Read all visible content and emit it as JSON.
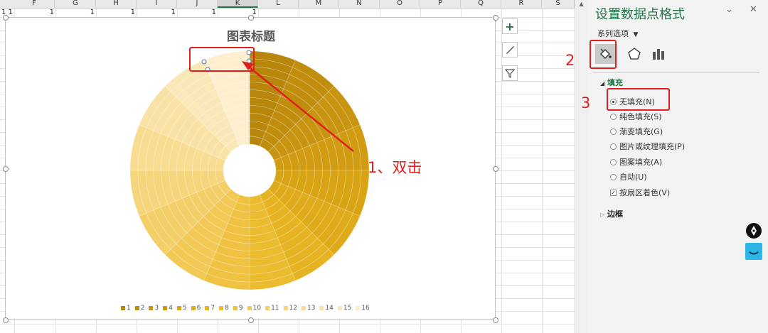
{
  "spreadsheet": {
    "columns": [
      "F",
      "G",
      "H",
      "I",
      "J",
      "K",
      "L",
      "M",
      "N",
      "O",
      "P",
      "Q",
      "R",
      "S"
    ],
    "selected_columns": [
      "K"
    ],
    "row1_values": [
      "1",
      "1",
      "1",
      "1",
      "1",
      "1",
      "1"
    ],
    "row1_value_last": "1"
  },
  "chart": {
    "title": "图表标题",
    "legend": [
      "1",
      "2",
      "3",
      "4",
      "5",
      "6",
      "7",
      "8",
      "9",
      "10",
      "11",
      "12",
      "13",
      "14",
      "15",
      "16"
    ],
    "side_buttons": [
      {
        "icon": "plus-icon",
        "glyph": "+"
      },
      {
        "icon": "brush-icon",
        "glyph": "✎"
      },
      {
        "icon": "filter-icon",
        "glyph": "⏷"
      }
    ]
  },
  "chart_data": {
    "type": "pie",
    "title": "图表标题",
    "variant": "doughnut",
    "categories": [
      "1",
      "2",
      "3",
      "4",
      "5",
      "6",
      "7",
      "8",
      "9",
      "10",
      "11",
      "12",
      "13",
      "14",
      "15",
      "16"
    ],
    "values": [
      1,
      1,
      1,
      1,
      1,
      1,
      1,
      1,
      1,
      1,
      1,
      1,
      1,
      1,
      1,
      1
    ],
    "colors": [
      "#b8860b",
      "#c08e0c",
      "#c99510",
      "#d19c12",
      "#d9a414",
      "#e0ab1a",
      "#e6b322",
      "#ebbb30",
      "#efc241",
      "#f2c954",
      "#f4cf68",
      "#f6d57c",
      "#f8dc91",
      "#f9e2a5",
      "#fbe8b9",
      "#fdeecd"
    ],
    "legend_position": "bottom"
  },
  "format_pane": {
    "title": "设置数据点格式",
    "series_options": "系列选项",
    "tabs": [
      {
        "icon": "fill-bucket-icon",
        "active": true
      },
      {
        "icon": "pentagon-icon",
        "active": false
      },
      {
        "icon": "bar-chart-icon",
        "active": false
      }
    ],
    "fill_section": "填充",
    "fill_options": [
      {
        "label": "无填充(N)",
        "selected": true
      },
      {
        "label": "纯色填充(S)",
        "selected": false
      },
      {
        "label": "渐变填充(G)",
        "selected": false
      },
      {
        "label": "图片或纹理填充(P)",
        "selected": false
      },
      {
        "label": "图案填充(A)",
        "selected": false
      },
      {
        "label": "自动(U)",
        "selected": false
      }
    ],
    "vary_colors": {
      "label": "按扇区着色(V)",
      "checked": true
    },
    "border_section": "边框"
  },
  "annotations": {
    "step1": "1、双击",
    "step2": "2",
    "step3": "3"
  }
}
